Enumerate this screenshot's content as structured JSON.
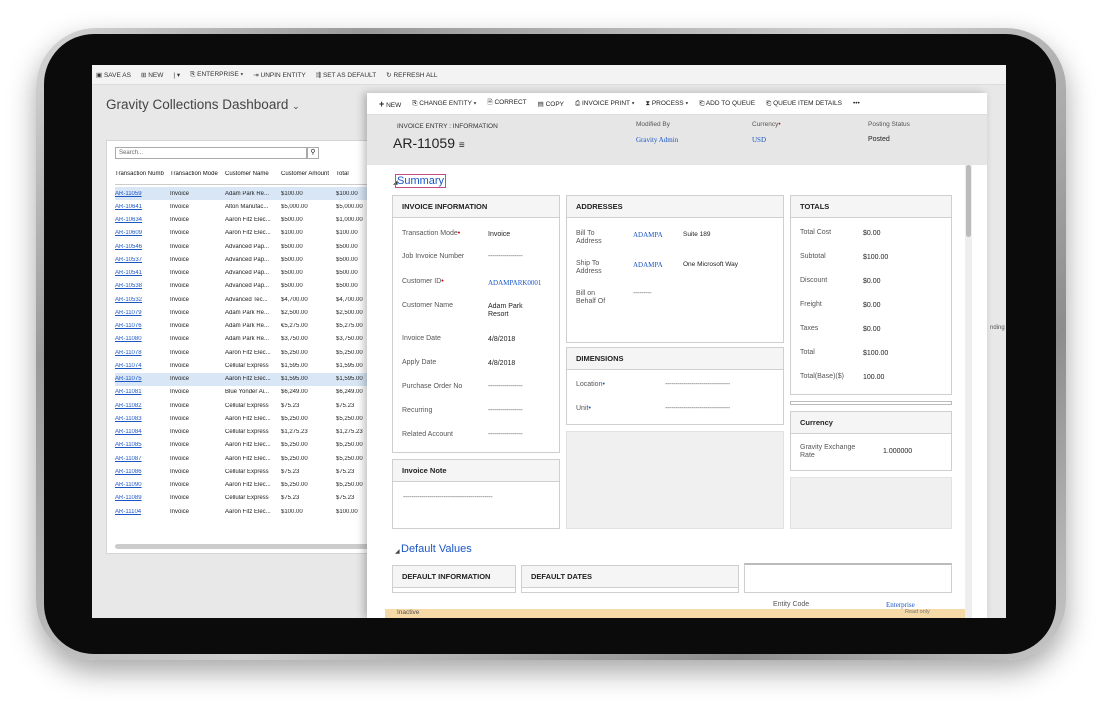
{
  "back_window": {
    "toolbar": [
      "SAVE AS",
      "NEW",
      "ENTERPRISE",
      "UNPIN ENTITY",
      "SET AS DEFAULT",
      "REFRESH ALL"
    ],
    "title": "Gravity Collections Dashboard",
    "search_placeholder": "Search...",
    "columns": [
      "Transaction Numb",
      "Transaction Mode",
      "Customer Name",
      "Customer Amount",
      "Total"
    ],
    "rows": [
      [
        "AR-11059",
        "Invoice",
        "Adam Park Re...",
        "$100.00",
        "$100.00"
      ],
      [
        "AR-10641",
        "Invoice",
        "Alton Manufac...",
        "$5,000.00",
        "$5,000.00"
      ],
      [
        "AR-10634",
        "Invoice",
        "Aaron Fitz Elec...",
        "$500.00",
        "$1,000.00"
      ],
      [
        "AR-10609",
        "Invoice",
        "Aaron Fitz Elec...",
        "$100.00",
        "$100.00"
      ],
      [
        "AR-10546",
        "Invoice",
        "Advanced Pap...",
        "$500.00",
        "$500.00"
      ],
      [
        "AR-10537",
        "Invoice",
        "Advanced Pap...",
        "$500.00",
        "$500.00"
      ],
      [
        "AR-10541",
        "Invoice",
        "Advanced Pap...",
        "$500.00",
        "$500.00"
      ],
      [
        "AR-10538",
        "Invoice",
        "Advanced Pap...",
        "$500.00",
        "$500.00"
      ],
      [
        "AR-10532",
        "Invoice",
        "Advanced Tec...",
        "$4,700.00",
        "$4,700.00"
      ],
      [
        "AR-11079",
        "Invoice",
        "Adam Park Re...",
        "$2,500.00",
        "$2,500.00"
      ],
      [
        "AR-11076",
        "Invoice",
        "Adam Park Re...",
        "€5,275.00",
        "$5,275.00"
      ],
      [
        "AR-11080",
        "Invoice",
        "Adam Park Re...",
        "$3,750.00",
        "$3,750.00"
      ],
      [
        "AR-11078",
        "Invoice",
        "Aaron Fitz Elec...",
        "$5,250.00",
        "$5,250.00"
      ],
      [
        "AR-11074",
        "Invoice",
        "Cellular Express",
        "$1,595.00",
        "$1,595.00"
      ],
      [
        "AR-11075",
        "Invoice",
        "Aaron Fitz Elec...",
        "$1,595.00",
        "$1,595.00"
      ],
      [
        "AR-11081",
        "Invoice",
        "Blue Yonder Ai...",
        "$6,249.00",
        "$6,249.00"
      ],
      [
        "AR-11082",
        "Invoice",
        "Cellular Express",
        "$75.23",
        "$75.23"
      ],
      [
        "AR-11083",
        "Invoice",
        "Aaron Fitz Elec...",
        "$5,250.00",
        "$5,250.00"
      ],
      [
        "AR-11084",
        "Invoice",
        "Cellular Express",
        "$1,275.23",
        "$1,275.23"
      ],
      [
        "AR-11085",
        "Invoice",
        "Aaron Fitz Elec...",
        "$5,250.00",
        "$5,250.00"
      ],
      [
        "AR-11087",
        "Invoice",
        "Aaron Fitz Elec...",
        "$5,250.00",
        "$5,250.00"
      ],
      [
        "AR-11086",
        "Invoice",
        "Cellular Express",
        "$75.23",
        "$75.23"
      ],
      [
        "AR-11090",
        "Invoice",
        "Aaron Fitz Elec...",
        "$5,250.00",
        "$5,250.00"
      ],
      [
        "AR-11089",
        "Invoice",
        "Cellular Express",
        "$75.23",
        "$75.23"
      ],
      [
        "AR-11104",
        "Invoice",
        "Aaron Fitz Elec...",
        "$100.00",
        "$100.00"
      ]
    ],
    "selected_rows": [
      0,
      14
    ],
    "right_fragment": "nding"
  },
  "form": {
    "toolbar": [
      "NEW",
      "CHANGE ENTITY",
      "CORRECT",
      "COPY",
      "INVOICE PRINT",
      "PROCESS",
      "ADD TO QUEUE",
      "QUEUE ITEM DETAILS",
      "•••"
    ],
    "eyebrow": "INVOICE ENTRY : INFORMATION",
    "record_id": "AR-11059",
    "modified_by_label": "Modified By",
    "modified_by": "Gravity Admin",
    "currency_label": "Currency",
    "currency": "USD",
    "posting_status_label": "Posting Status",
    "posting_status": "Posted",
    "summary_title": "Summary",
    "invoice_info": {
      "header": "INVOICE INFORMATION",
      "transaction_mode_label": "Transaction Mode",
      "transaction_mode": "Invoice",
      "job_invoice_label": "Job Invoice Number",
      "customer_id_label": "Customer ID",
      "customer_id": "ADAMPARK0001",
      "customer_name_label": "Customer Name",
      "customer_name_1": "Adam Park",
      "customer_name_2": "Resort",
      "invoice_date_label": "Invoice Date",
      "invoice_date": "4/8/2018",
      "apply_date_label": "Apply Date",
      "apply_date": "4/8/2018",
      "po_label": "Purchase Order No",
      "recurring_label": "Recurring",
      "related_account_label": "Related Account",
      "empty": "-----------------"
    },
    "addresses": {
      "header": "ADDRESSES",
      "bill_to_label_1": "Bill To",
      "bill_to_label_2": "Address",
      "bill_to_code": "ADAMPA",
      "bill_to_value": "Suite 189",
      "ship_to_label_1": "Ship To",
      "ship_to_label_2": "Address",
      "ship_to_code": "ADAMPA",
      "ship_to_value": "One Microsoft Way",
      "behalf_label_1": "Bill on",
      "behalf_label_2": "Behalf Of",
      "empty_short": "---------"
    },
    "dimensions": {
      "header": "DIMENSIONS",
      "location_label": "Location",
      "unit_label": "Unit",
      "empty_long": "--------------------------------"
    },
    "totals": {
      "header": "TOTALS",
      "rows": [
        [
          "Total Cost",
          "$0.00"
        ],
        [
          "Subtotal",
          "$100.00"
        ],
        [
          "Discount",
          "$0.00"
        ],
        [
          "Freight",
          "$0.00"
        ],
        [
          "Taxes",
          "$0.00"
        ],
        [
          "Total",
          "$100.00"
        ],
        [
          "Total(Base)($)",
          "100.00"
        ]
      ]
    },
    "currency_card": {
      "header": "Currency",
      "rate_label_1": "Gravity Exchange",
      "rate_label_2": "Rate",
      "rate": "1.000000"
    },
    "invoice_note": {
      "header": "Invoice Note",
      "empty": "--------------------------------------------"
    },
    "default_values_title": "Default Values",
    "default_info_header": "DEFAULT INFORMATION",
    "default_dates_header": "DEFAULT DATES",
    "entity_code_label": "Entity Code",
    "entity_code": "Enterprise",
    "status_bar": "Inactive",
    "status_bar_right": "Read only"
  }
}
